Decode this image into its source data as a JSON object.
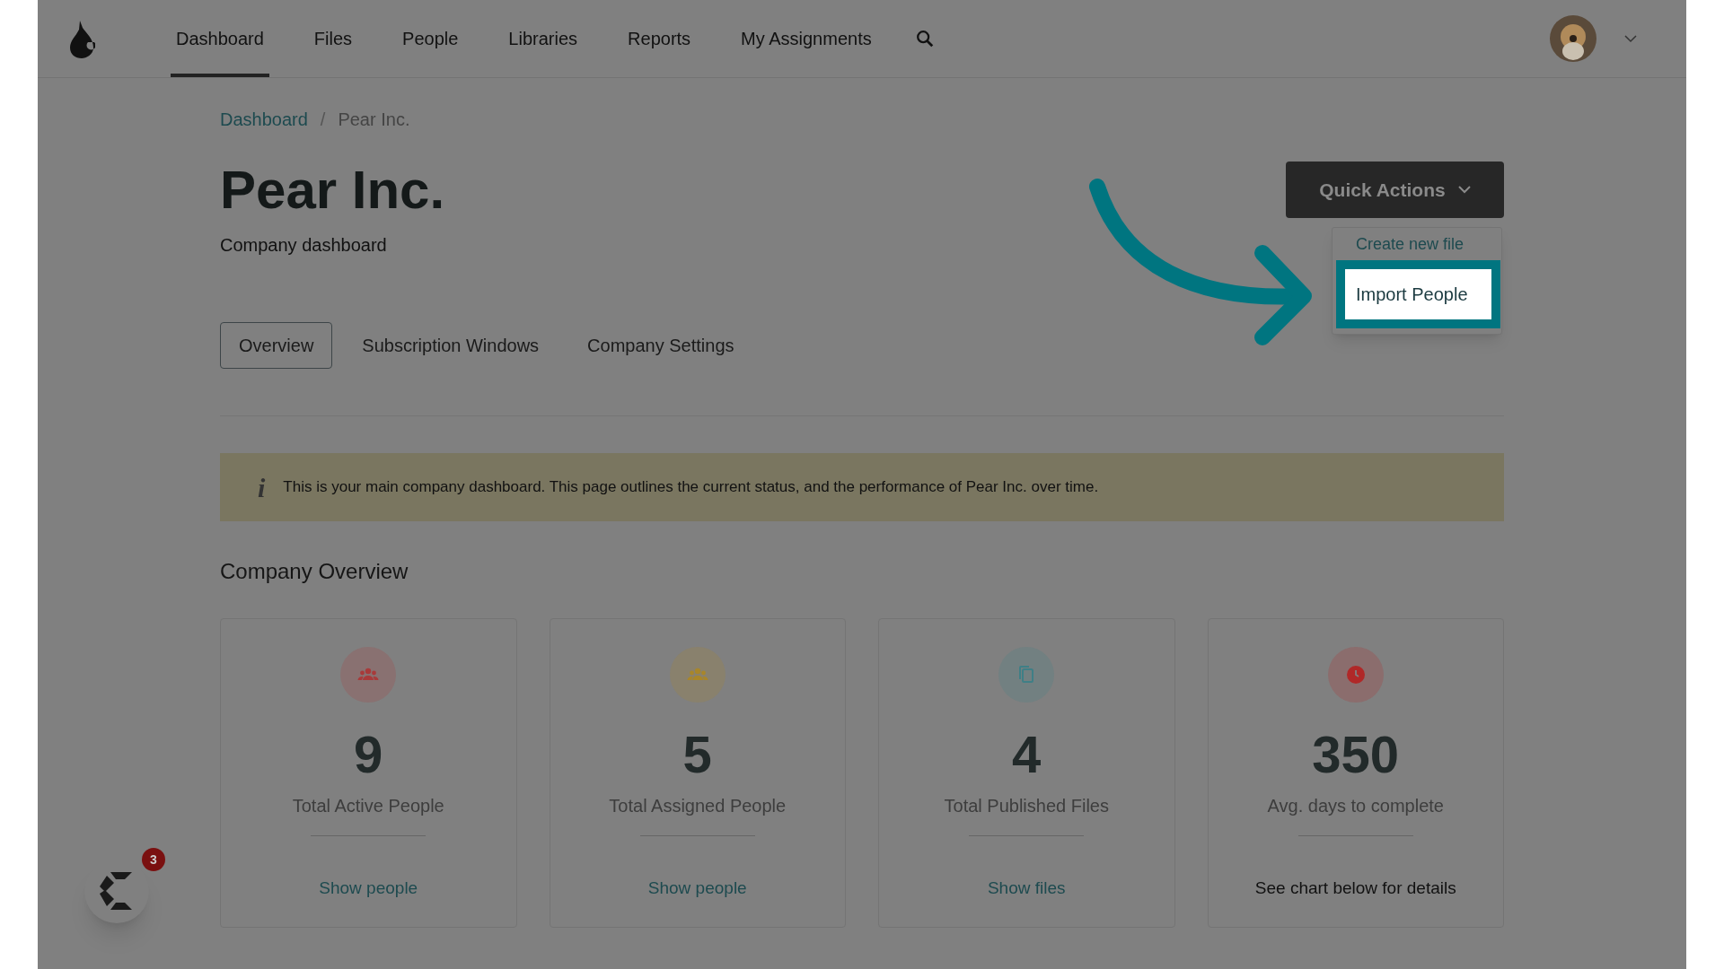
{
  "nav": {
    "items": [
      {
        "label": "Dashboard",
        "selected": true
      },
      {
        "label": "Files",
        "selected": false
      },
      {
        "label": "People",
        "selected": false
      },
      {
        "label": "Libraries",
        "selected": false
      },
      {
        "label": "Reports",
        "selected": false
      },
      {
        "label": "My Assignments",
        "selected": false
      }
    ]
  },
  "breadcrumb": {
    "items": [
      "Dashboard",
      "Pear Inc."
    ],
    "separator": "/"
  },
  "page": {
    "title": "Pear Inc.",
    "subtitle": "Company dashboard"
  },
  "quick_actions": {
    "label": "Quick Actions",
    "expanded": true,
    "menu": [
      {
        "label": "Create new file",
        "highlighted": false
      },
      {
        "label": "Import People",
        "highlighted": true
      }
    ]
  },
  "tabs": [
    {
      "label": "Overview",
      "selected": true
    },
    {
      "label": "Subscription Windows",
      "selected": false
    },
    {
      "label": "Company Settings",
      "selected": false
    }
  ],
  "info_banner": {
    "icon": "i",
    "text": "This is your main company dashboard. This page outlines the current status, and the performance of Pear Inc. over time."
  },
  "section_title": "Company Overview",
  "cards": [
    {
      "kind": "people",
      "color": "#a83a3a",
      "value": "9",
      "label": "Total Active People",
      "link": "Show people"
    },
    {
      "kind": "people",
      "color": "#a8862a",
      "value": "5",
      "label": "Total Assigned People",
      "link": "Show people"
    },
    {
      "kind": "files",
      "color": "#3f7f86",
      "value": "4",
      "label": "Total Published Files",
      "link": "Show files"
    },
    {
      "kind": "clock",
      "color": "#b02828",
      "value": "350",
      "label": "Avg. days to complete",
      "note": "See chart below for details"
    }
  ],
  "chat_badge": {
    "count": "3"
  }
}
